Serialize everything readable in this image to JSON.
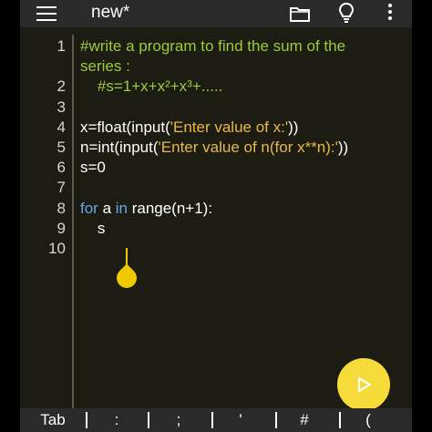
{
  "app": {
    "title": "new*"
  },
  "icons": {
    "menu": "hamburger-menu-icon",
    "folder": "folder-icon",
    "bulb": "lightbulb-icon",
    "more": "more-vertical-icon",
    "run": "play-icon"
  },
  "colors": {
    "background": "#1c1c12",
    "bar": "#2a2a2a",
    "comment": "#9ccc3c",
    "keyword": "#6aa8e8",
    "string": "#e8b84a",
    "accent": "#f5dc3a"
  },
  "editor": {
    "lines": [
      {
        "num": "1",
        "parts": [
          {
            "t": "#write a program to find the sum of the",
            "c": "cmt"
          }
        ]
      },
      {
        "num": "",
        "parts": [
          {
            "t": "series :",
            "c": "cmt"
          }
        ]
      },
      {
        "num": "2",
        "parts": [
          {
            "t": "    #s=1+x+x²+x³+.....",
            "c": "cmt"
          }
        ]
      },
      {
        "num": "3",
        "parts": []
      },
      {
        "num": "4",
        "parts": [
          {
            "t": "x=float(input(",
            "c": ""
          },
          {
            "t": "'Enter value of x:'",
            "c": "str"
          },
          {
            "t": "))",
            "c": ""
          }
        ]
      },
      {
        "num": "5",
        "parts": [
          {
            "t": "n=int(input(",
            "c": ""
          },
          {
            "t": "'Enter value of n(for x**n):'",
            "c": "str"
          },
          {
            "t": "))",
            "c": ""
          }
        ]
      },
      {
        "num": "6",
        "parts": [
          {
            "t": "s=0",
            "c": ""
          }
        ]
      },
      {
        "num": "7",
        "parts": []
      },
      {
        "num": "8",
        "parts": [
          {
            "t": "for",
            "c": "kw"
          },
          {
            "t": " a ",
            "c": ""
          },
          {
            "t": "in",
            "c": "kw"
          },
          {
            "t": " range(n+1):",
            "c": ""
          }
        ]
      },
      {
        "num": "9",
        "parts": [
          {
            "t": "    s",
            "c": ""
          }
        ]
      },
      {
        "num": "10",
        "parts": []
      }
    ]
  },
  "keys": [
    "Tab",
    ":",
    ";",
    "'",
    "#",
    "("
  ]
}
